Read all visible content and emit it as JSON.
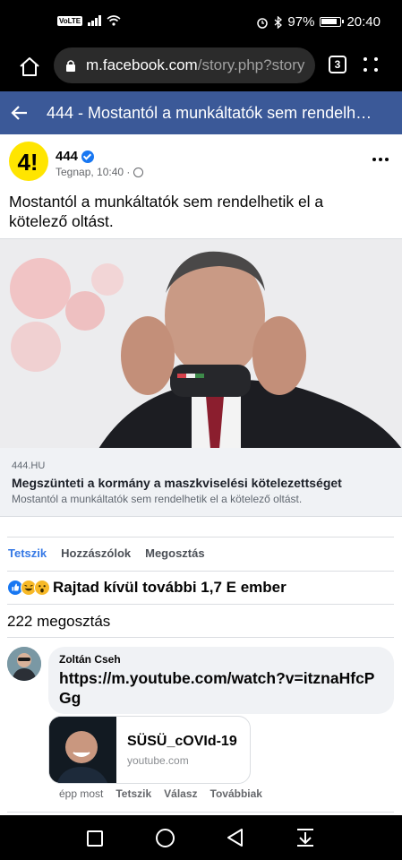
{
  "status_bar": {
    "volte": "VoLTE",
    "battery": "97%",
    "time": "20:40"
  },
  "browser": {
    "url_host": "m.facebook.com",
    "url_path": "/story.php?story",
    "tab_count": "3"
  },
  "fb_header": {
    "title": "444 - Mostantól a munkáltatók sem rendelh…"
  },
  "post": {
    "page_name": "444",
    "avatar_text": "4!",
    "time": "Tegnap, 10:40 ·",
    "text": "Mostantól a munkáltatók sem rendelhetik el a kötelező oltást.",
    "link": {
      "domain": "444.HU",
      "title": "Megszünteti a kormány a maszkviselési kötelezettséget",
      "description": "Mostantól a munkáltatók sem rendelhetik el a kötelező oltást."
    },
    "actions": {
      "like": "Tetszik",
      "comment": "Hozzászólok",
      "share": "Megosztás"
    },
    "reactions_text": "Rajtad kívül további 1,7 E ember",
    "shares_text": "222 megosztás"
  },
  "comment": {
    "author": "Zoltán Cseh",
    "text": "https://m.youtube.com/watch?v=itznaHfcPGg",
    "preview": {
      "title": "SÜSÜ_cOVId-19",
      "domain": "youtube.com"
    },
    "time": "épp most",
    "like": "Tetszik",
    "reply": "Válasz",
    "more": "Továbbiak"
  }
}
